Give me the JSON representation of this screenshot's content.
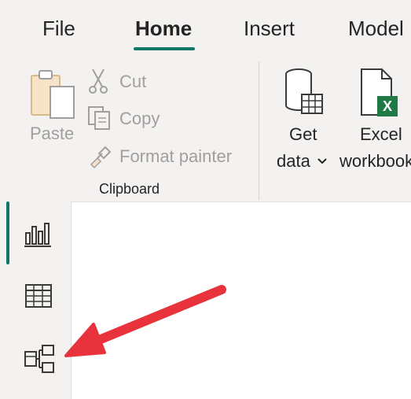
{
  "menu": {
    "tabs": [
      {
        "label": "File"
      },
      {
        "label": "Home"
      },
      {
        "label": "Insert"
      },
      {
        "label": "Model"
      }
    ]
  },
  "ribbon": {
    "clipboard": {
      "paste_label": "Paste",
      "cut_label": "Cut",
      "copy_label": "Copy",
      "format_painter_label": "Format painter",
      "group_label": "Clipboard"
    },
    "data": {
      "get_data_line1": "Get",
      "get_data_line2": "data",
      "excel_line1": "Excel",
      "excel_line2": "workbook"
    }
  },
  "sidebar": {
    "items": [
      {
        "icon": "report-view-icon",
        "active": true
      },
      {
        "icon": "table-view-icon",
        "active": false
      },
      {
        "icon": "model-view-icon",
        "active": false
      }
    ]
  },
  "annotation": {
    "arrow_color": "#e8323c"
  },
  "colors": {
    "accent": "#117865",
    "excel_green": "#1f7a45"
  }
}
